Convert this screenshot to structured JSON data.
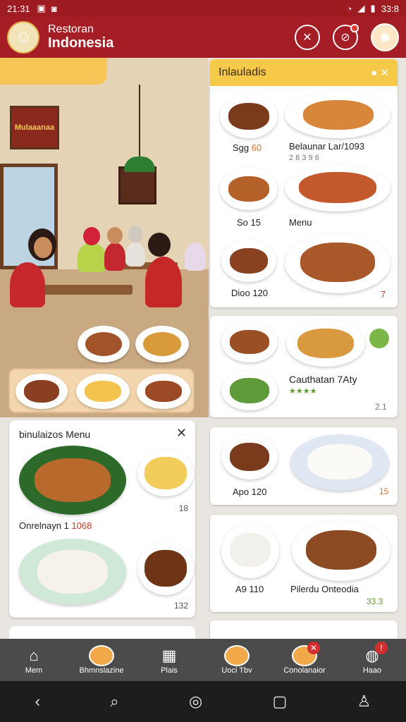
{
  "status": {
    "time": "21:31",
    "time_right": "33:8",
    "icons": [
      "sim-icon",
      "wifi-icon",
      "signal-icon",
      "battery-icon"
    ]
  },
  "header": {
    "line1": "Restoran",
    "line2": "Indonesia",
    "colors": {
      "bar": "#a51d25",
      "accent": "#f7c948"
    }
  },
  "scene": {
    "sign": "Mulaaanaa"
  },
  "left_card": {
    "title": "binulaizos Menu",
    "caption": "Onrelnayn 1",
    "caption_red": "1068",
    "num1": "18",
    "num2": "132"
  },
  "panel": {
    "title": "Inlauladis",
    "rows": [
      {
        "left": "Sgg",
        "left_extra": "60",
        "right": "Belaunar Lar/1093",
        "right_sub": "2 8 3 9 6"
      },
      {
        "left": "So 15",
        "right": "Menu"
      },
      {
        "left": "Dioo 120",
        "right_num": "7"
      }
    ]
  },
  "cards": [
    {
      "title": "Cauthatan 7Aty",
      "sub": "★★★★",
      "num": "2.1"
    },
    {
      "title": "Apo 120",
      "num": "15"
    },
    {
      "left": "A9 110",
      "title": "Pilerdu Onteodia",
      "num": "33.3"
    }
  ],
  "bottom_nav": [
    {
      "label": "Mem",
      "icon": "home-icon"
    },
    {
      "label": "Bhmnslazine",
      "icon": "food-icon"
    },
    {
      "label": "Plais",
      "icon": "calendar-icon"
    },
    {
      "label": "Uoci Tbv",
      "icon": "food-icon"
    },
    {
      "label": "Conolanaior",
      "icon": "food-icon"
    },
    {
      "label": "Haao",
      "icon": "chat-icon",
      "badge": ""
    }
  ],
  "sys_nav": [
    "back-icon",
    "search-icon",
    "home-circle-icon",
    "recents-icon",
    "profile-icon"
  ]
}
